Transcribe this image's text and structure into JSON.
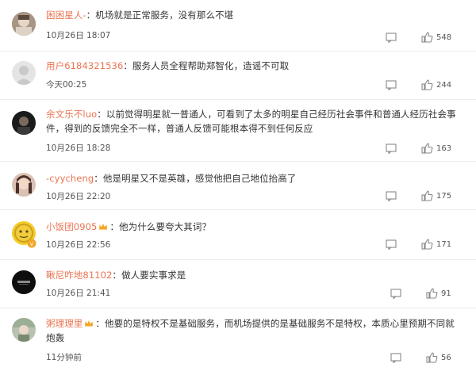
{
  "comments": [
    {
      "username": "困困星人-",
      "separator": "：",
      "content": "机场就是正常服务，没有那么不堪",
      "time": "10月26日 18:07",
      "likes": "548",
      "icons": {
        "reply": "comment-icon",
        "like": "thumbs-up-icon"
      }
    },
    {
      "username": "用户6184321536",
      "separator": "：",
      "content": "服务人员全程帮助郑智化，造谣不可取",
      "time": "今天00:25",
      "likes": "244",
      "icons": {
        "reply": "comment-icon",
        "like": "thumbs-up-icon"
      }
    },
    {
      "username": "余文乐不luo",
      "separator": "：",
      "content": "以前觉得明星就一普通人，可看到了太多的明星自己经历社会事件和普通人经历社会事件，得到的反馈完全不一样，普通人反馈可能根本得不到任何反应",
      "time": "10月26日 18:28",
      "likes": "163",
      "icons": {
        "reply": "comment-icon",
        "like": "thumbs-up-icon"
      }
    },
    {
      "username": "-cyycheng",
      "separator": "：",
      "content": "他是明星又不是英雄，感觉他把自己地位抬高了",
      "time": "10月26日 22:20",
      "likes": "175",
      "icons": {
        "reply": "comment-icon",
        "like": "thumbs-up-icon"
      }
    },
    {
      "username": "小饭团0905",
      "separator": "：",
      "content": "他为什么要夸大其词？",
      "time": "10月26日 22:56",
      "likes": "171",
      "badge": "crown-badge-icon",
      "icons": {
        "reply": "comment-icon",
        "like": "thumbs-up-icon"
      }
    },
    {
      "username": "瞅尼咋地81102",
      "separator": "：",
      "content": "做人要实事求是",
      "time": "10月26日 21:41",
      "likes": "91",
      "icons": {
        "reply": "comment-icon",
        "like": "thumbs-up-icon"
      }
    },
    {
      "username": "粥理理里",
      "separator": "：",
      "content": "他要的是特权不是基础服务，而机场提供的是基础服务不是特权，本质心里预期不同就炮轰",
      "time": "11分钟前",
      "likes": "56",
      "badge": "crown-badge-icon",
      "icons": {
        "reply": "comment-icon",
        "like": "thumbs-up-icon"
      }
    }
  ],
  "colors": {
    "username": "#eb7350",
    "text": "#333333",
    "meta": "#555555",
    "divider": "#ececec",
    "crown": "#f5a623"
  }
}
